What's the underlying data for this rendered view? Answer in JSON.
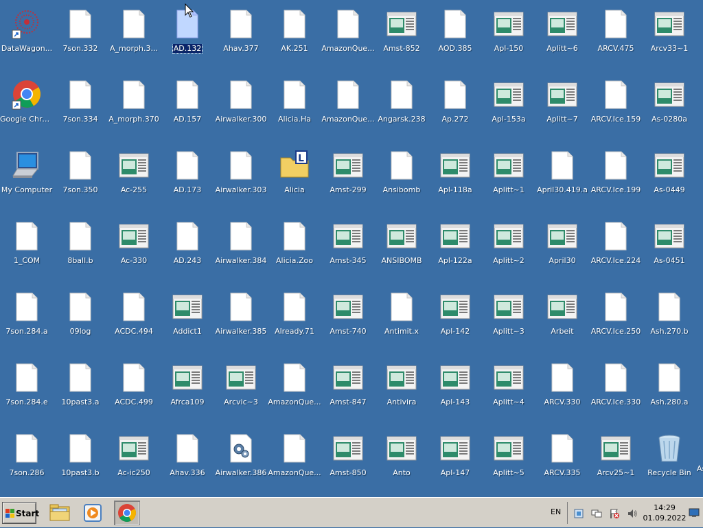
{
  "desktop": {
    "selected_icon": "AD.132",
    "columns": [
      [
        {
          "label": "DataWagon...",
          "type": "datawagon"
        },
        {
          "label": "Google Chrome",
          "type": "chrome"
        },
        {
          "label": "My Computer",
          "type": "computer"
        },
        {
          "label": "1_COM",
          "type": "file"
        },
        {
          "label": "7son.284.a",
          "type": "file"
        },
        {
          "label": "7son.284.e",
          "type": "file"
        },
        {
          "label": "7son.286",
          "type": "file"
        }
      ],
      [
        {
          "label": "7son.332",
          "type": "file"
        },
        {
          "label": "7son.334",
          "type": "file"
        },
        {
          "label": "7son.350",
          "type": "file"
        },
        {
          "label": "8ball.b",
          "type": "file"
        },
        {
          "label": "09log",
          "type": "file"
        },
        {
          "label": "10past3.a",
          "type": "file"
        },
        {
          "label": "10past3.b",
          "type": "file"
        }
      ],
      [
        {
          "label": "A_morph.3...",
          "type": "file"
        },
        {
          "label": "A_morph.370",
          "type": "file"
        },
        {
          "label": "Ac-255",
          "type": "app"
        },
        {
          "label": "Ac-330",
          "type": "app"
        },
        {
          "label": "ACDC.494",
          "type": "file"
        },
        {
          "label": "ACDC.499",
          "type": "file"
        },
        {
          "label": "Ac-ic250",
          "type": "app"
        }
      ],
      [
        {
          "label": "AD.132",
          "type": "file"
        },
        {
          "label": "AD.157",
          "type": "file"
        },
        {
          "label": "AD.173",
          "type": "file"
        },
        {
          "label": "AD.243",
          "type": "file"
        },
        {
          "label": "Addict1",
          "type": "app"
        },
        {
          "label": "Afrca109",
          "type": "app"
        },
        {
          "label": "Ahav.336",
          "type": "file"
        }
      ],
      [
        {
          "label": "Ahav.377",
          "type": "file"
        },
        {
          "label": "Airwalker.300",
          "type": "file"
        },
        {
          "label": "Airwalker.303",
          "type": "file"
        },
        {
          "label": "Airwalker.384",
          "type": "file"
        },
        {
          "label": "Airwalker.385",
          "type": "file"
        },
        {
          "label": "Arcvic~3",
          "type": "app"
        },
        {
          "label": "Airwalker.386",
          "type": "config"
        }
      ],
      [
        {
          "label": "AK.251",
          "type": "file"
        },
        {
          "label": "Alicia.Ha",
          "type": "file"
        },
        {
          "label": "Alicia",
          "type": "folder"
        },
        {
          "label": "Alicia.Zoo",
          "type": "file"
        },
        {
          "label": "Already.71",
          "type": "file"
        },
        {
          "label": "AmazonQue...",
          "type": "file"
        },
        {
          "label": "AmazonQue...",
          "type": "file"
        }
      ],
      [
        {
          "label": "AmazonQue...",
          "type": "file"
        },
        {
          "label": "AmazonQue...",
          "type": "file"
        },
        {
          "label": "Amst-299",
          "type": "app"
        },
        {
          "label": "Amst-345",
          "type": "app"
        },
        {
          "label": "Amst-740",
          "type": "app"
        },
        {
          "label": "Amst-847",
          "type": "app"
        },
        {
          "label": "Amst-850",
          "type": "app"
        }
      ],
      [
        {
          "label": "Amst-852",
          "type": "app"
        },
        {
          "label": "Angarsk.238",
          "type": "file"
        },
        {
          "label": "Ansibomb",
          "type": "file"
        },
        {
          "label": "ANSIBOMB",
          "type": "app"
        },
        {
          "label": "Antimit.x",
          "type": "file"
        },
        {
          "label": "Antivira",
          "type": "app"
        },
        {
          "label": "Anto",
          "type": "app"
        }
      ],
      [
        {
          "label": "AOD.385",
          "type": "file"
        },
        {
          "label": "Ap.272",
          "type": "file"
        },
        {
          "label": "Apl-118a",
          "type": "app"
        },
        {
          "label": "Apl-122a",
          "type": "app"
        },
        {
          "label": "Apl-142",
          "type": "app"
        },
        {
          "label": "Apl-143",
          "type": "app"
        },
        {
          "label": "Apl-147",
          "type": "app"
        }
      ],
      [
        {
          "label": "Apl-150",
          "type": "app"
        },
        {
          "label": "Apl-153a",
          "type": "app"
        },
        {
          "label": "Aplitt~1",
          "type": "app"
        },
        {
          "label": "Aplitt~2",
          "type": "app"
        },
        {
          "label": "Aplitt~3",
          "type": "app"
        },
        {
          "label": "Aplitt~4",
          "type": "app"
        },
        {
          "label": "Aplitt~5",
          "type": "app"
        }
      ],
      [
        {
          "label": "Aplitt~6",
          "type": "app"
        },
        {
          "label": "Aplitt~7",
          "type": "app"
        },
        {
          "label": "April30.419.a",
          "type": "file"
        },
        {
          "label": "April30",
          "type": "app"
        },
        {
          "label": "Arbeit",
          "type": "app"
        },
        {
          "label": "ARCV.330",
          "type": "file"
        },
        {
          "label": "ARCV.335",
          "type": "file"
        }
      ],
      [
        {
          "label": "ARCV.475",
          "type": "file"
        },
        {
          "label": "ARCV.Ice.159",
          "type": "file"
        },
        {
          "label": "ARCV.Ice.199",
          "type": "file"
        },
        {
          "label": "ARCV.Ice.224",
          "type": "file"
        },
        {
          "label": "ARCV.Ice.250",
          "type": "file"
        },
        {
          "label": "ARCV.Ice.330",
          "type": "file"
        },
        {
          "label": "Arcv25~1",
          "type": "app"
        }
      ],
      [
        {
          "label": "Arcv33~1",
          "type": "app"
        },
        {
          "label": "As-0280a",
          "type": "app"
        },
        {
          "label": "As-0449",
          "type": "app"
        },
        {
          "label": "As-0451",
          "type": "app"
        },
        {
          "label": "Ash.270.b",
          "type": "file"
        },
        {
          "label": "Ash.280.a",
          "type": "file"
        },
        {
          "label": "Recycle Bin",
          "type": "recycle"
        }
      ]
    ],
    "partial_label": "As"
  },
  "taskbar": {
    "start_label": "Start",
    "language": "EN",
    "clock_time": "14:29",
    "clock_date": "01.09.2022",
    "pinned": [
      {
        "name": "file-explorer-icon"
      },
      {
        "name": "media-player-icon"
      },
      {
        "name": "chrome-icon"
      }
    ],
    "tray": [
      {
        "name": "action-center-icon"
      },
      {
        "name": "network-icon"
      },
      {
        "name": "flag-warning-icon"
      },
      {
        "name": "volume-icon"
      }
    ]
  }
}
